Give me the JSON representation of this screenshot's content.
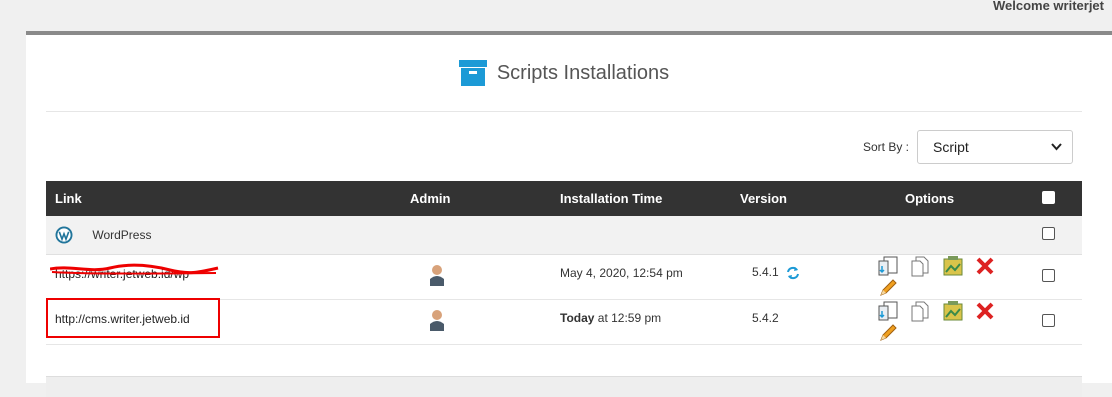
{
  "header": {
    "welcome": "Welcome writerjet"
  },
  "panel": {
    "title": "Scripts Installations",
    "box_icon": "archive-box-icon",
    "accent": "#1c9ad6"
  },
  "sort": {
    "label": "Sort By :",
    "selected": "Script"
  },
  "table": {
    "columns": [
      "Link",
      "Admin",
      "Installation Time",
      "Version",
      "Options"
    ],
    "group": {
      "name": "WordPress",
      "icon": "wordpress-icon"
    },
    "rows": [
      {
        "link": "https://writer.jetweb.id/wp",
        "time": "May 4, 2020, 12:54 pm",
        "version": "5.4.1",
        "redacted": true
      },
      {
        "link": "http://cms.writer.jetweb.id",
        "time_bold": "Today",
        "time_rest": " at 12:59 pm",
        "version": "5.4.2",
        "redacted": false
      }
    ],
    "option_icons": [
      "backup-icon",
      "clone-icon",
      "staging-icon",
      "remove-icon",
      "edit-icon"
    ]
  }
}
